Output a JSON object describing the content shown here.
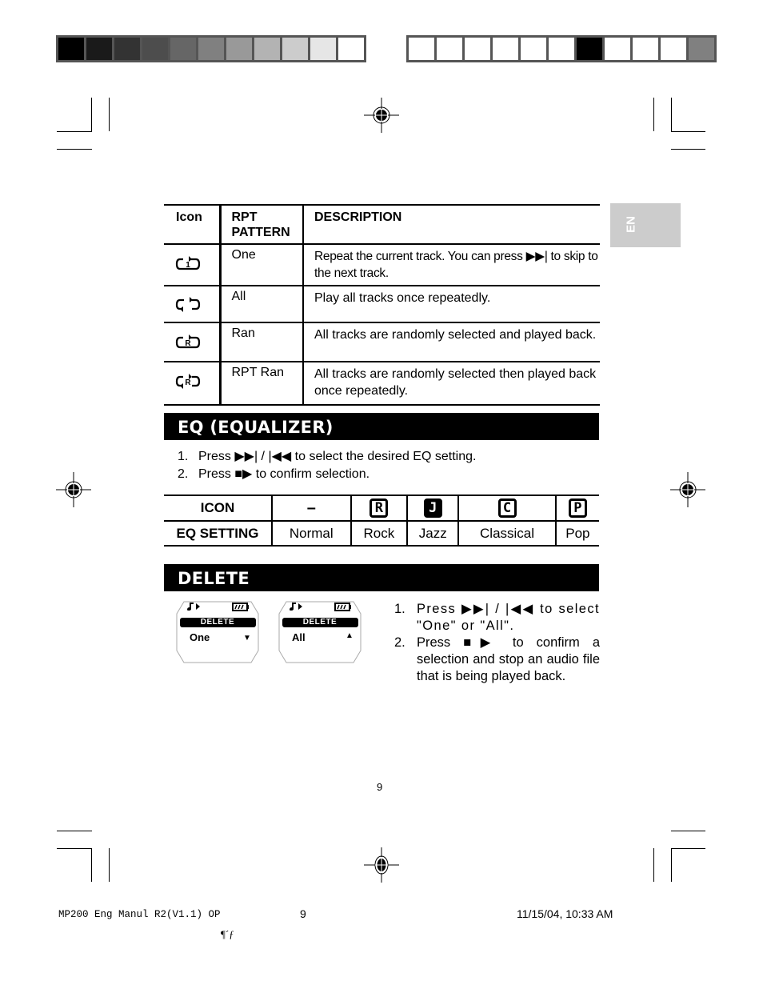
{
  "color_bar_left": [
    "#000000",
    "#1a1a1a",
    "#333333",
    "#4d4d4d",
    "#666666",
    "#808080",
    "#999999",
    "#b3b3b3",
    "#cccccc",
    "#e6e6e6",
    "#ffffff"
  ],
  "color_bar_right": [
    "#ffffff",
    "#ffffff",
    "#ffffff",
    "#ffffff",
    "#ffffff",
    "#ffffff",
    "#000000",
    "#ffffff",
    "#ffffff",
    "#ffffff",
    "#808080"
  ],
  "side_tab": {
    "label": "EN"
  },
  "repeat_table": {
    "headers": {
      "icon": "Icon",
      "pattern": "RPT PATTERN",
      "description": "DESCRIPTION"
    },
    "rows": [
      {
        "icon": "repeat-one-icon",
        "pattern": "One",
        "description": "Repeat the current track. You can press ▶▶| to skip to the next track."
      },
      {
        "icon": "repeat-all-icon",
        "pattern": "All",
        "description": "Play all tracks once repeatedly."
      },
      {
        "icon": "random-icon",
        "pattern": "Ran",
        "description": "All tracks are randomly selected and played back."
      },
      {
        "icon": "repeat-random-icon",
        "pattern": "RPT Ran",
        "description": "All tracks are randomly selected then played back once repeatedly."
      }
    ]
  },
  "eq_section": {
    "title": "EQ (EQUALIZER)",
    "steps": [
      {
        "num": "1.",
        "text": "Press ▶▶| / |◀◀ to select the desired EQ setting."
      },
      {
        "num": "2.",
        "text": "Press ■▶ to confirm selection."
      }
    ],
    "table": {
      "row1_label": "ICON",
      "row2_label": "EQ SETTING",
      "items": [
        {
          "icon": "–",
          "setting": "Normal"
        },
        {
          "icon": "R",
          "setting": "Rock"
        },
        {
          "icon": "J",
          "setting": "Jazz"
        },
        {
          "icon": "C",
          "setting": "Classical"
        },
        {
          "icon": "P",
          "setting": "Pop"
        }
      ]
    }
  },
  "delete_section": {
    "title": "DELETE",
    "screens": [
      {
        "header": "DELETE",
        "value": "One",
        "arrow": "▼"
      },
      {
        "header": "DELETE",
        "value": "All",
        "arrow": "▲"
      }
    ],
    "steps": [
      {
        "num": "1.",
        "text": "Press ▶▶| / |◀◀ to select \"One\" or \"All\"."
      },
      {
        "num": "2.",
        "text": "Press ■▶ to confirm a selection and stop an audio file that is being played back."
      }
    ]
  },
  "page_number": "9",
  "footer": {
    "file": "MP200 Eng Manul R2(V1.1) OP",
    "page": "9",
    "timestamp": "11/15/04, 10:33 AM",
    "glyphs": "¶´ƒ"
  }
}
